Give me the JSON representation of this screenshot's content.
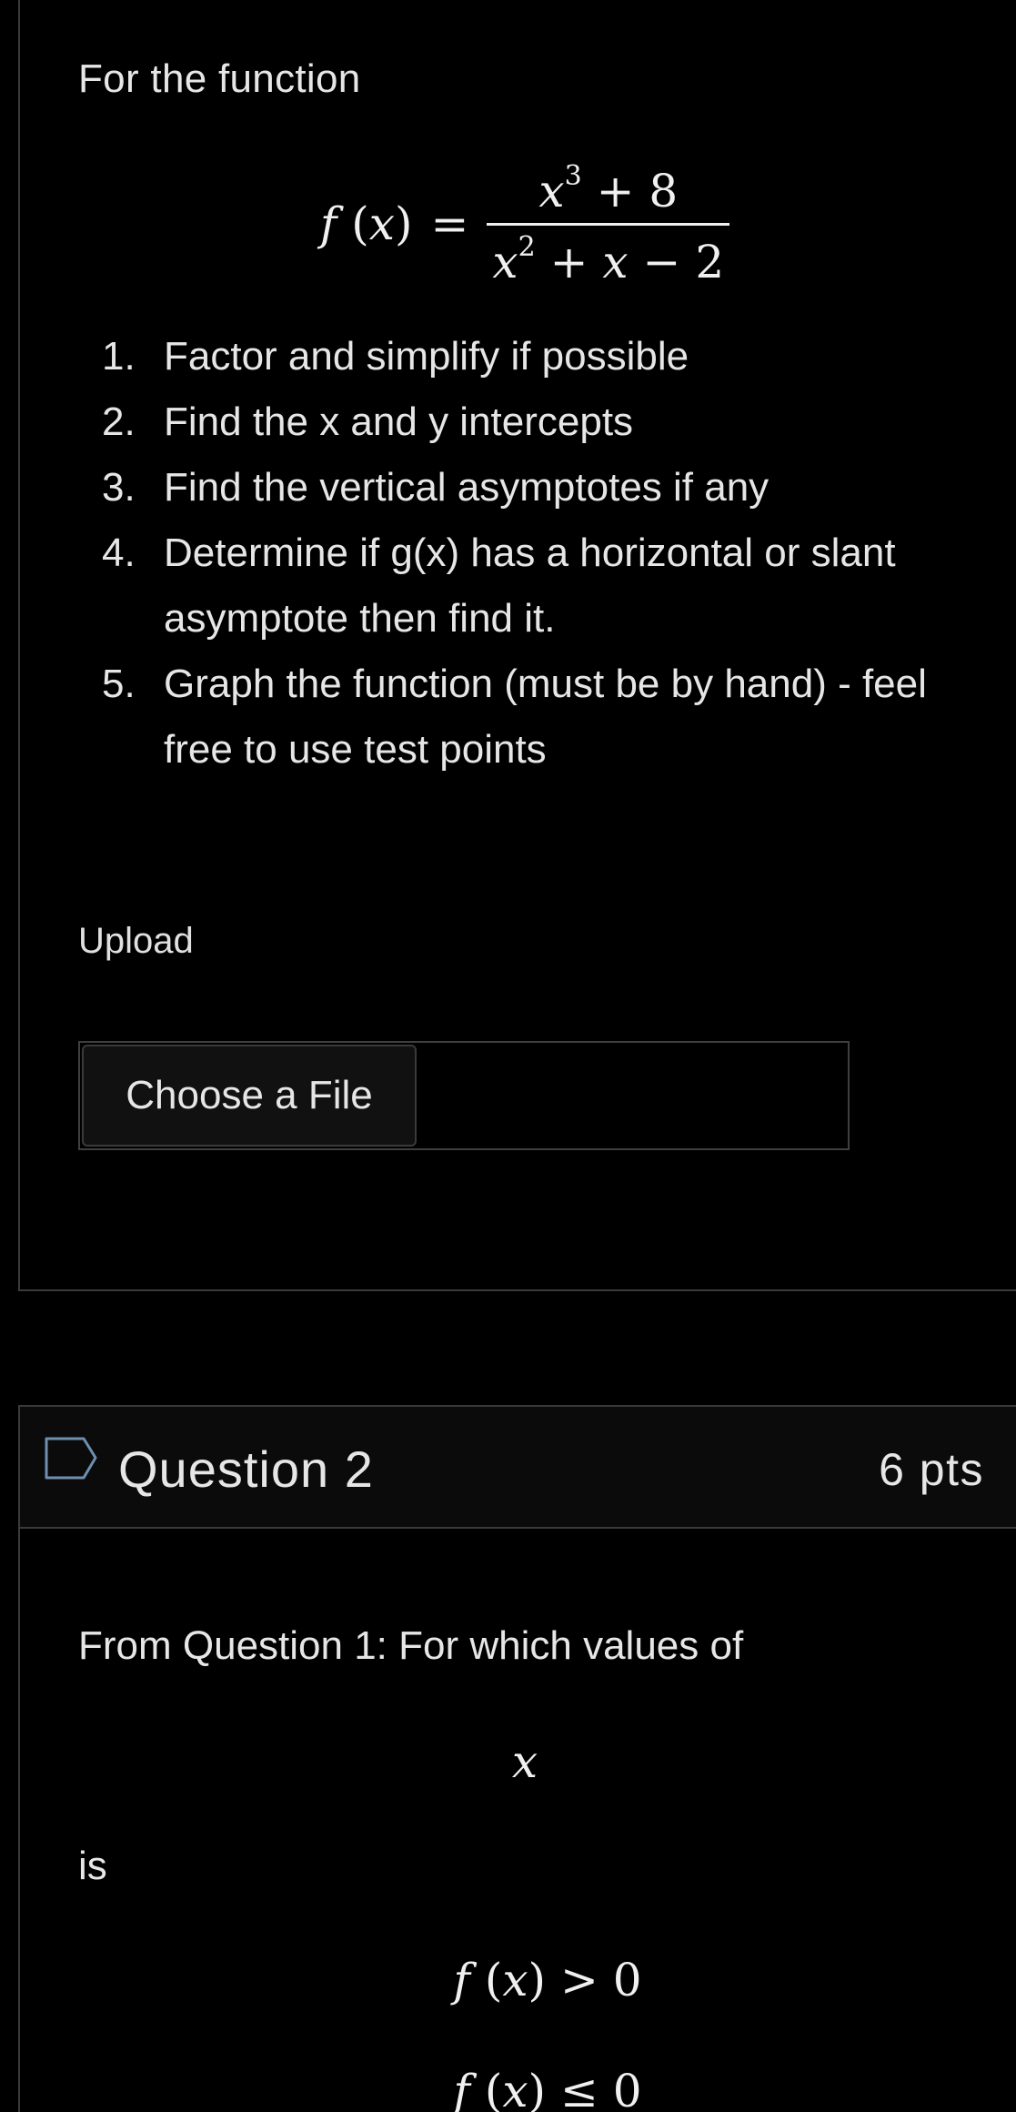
{
  "question1": {
    "intro": "For the function",
    "equation": {
      "lhs_func": "f",
      "lhs_arg": "x",
      "equals": "=",
      "numerator_var": "x",
      "numerator_exp": "3",
      "numerator_rest": "+ 8",
      "denominator_var": "x",
      "denominator_exp": "2",
      "denominator_rest_1": "+",
      "denominator_rest_var": "x",
      "denominator_rest_2": "− 2"
    },
    "steps": [
      {
        "marker": "1.",
        "text": "Factor and simplify if possible"
      },
      {
        "marker": "2.",
        "text": "Find the x and y intercepts"
      },
      {
        "marker": "3.",
        "text": "Find the vertical asymptotes if any"
      },
      {
        "marker": "4.",
        "text": "Determine if g(x) has a horizontal or slant asymptote then find it."
      },
      {
        "marker": "5.",
        "text": "Graph the function (must be by hand) - feel free to use test points"
      }
    ],
    "upload_label": "Upload",
    "choose_file_label": "Choose a File"
  },
  "question2": {
    "title": "Question 2",
    "points": "6 pts",
    "text": "From Question 1: For which values of",
    "variable": "x",
    "is_text": "is",
    "condition1": {
      "func": "f",
      "arg": "x",
      "op": "> 0"
    },
    "condition2": {
      "func": "f",
      "arg": "x",
      "op": "≤ 0"
    }
  },
  "colors": {
    "background": "#000000",
    "text": "#e6e6e6",
    "border": "#3a3a3a",
    "header_bg": "#0b0b0b",
    "flag_stroke": "#6f8fb0"
  },
  "icons": {
    "flag": "flag-icon"
  }
}
